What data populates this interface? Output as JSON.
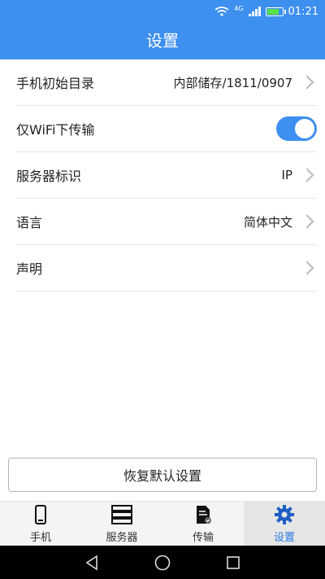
{
  "status_bar": {
    "network": "4G",
    "time": "01:21"
  },
  "header": {
    "title": "设置"
  },
  "settings": {
    "initial_dir": {
      "label": "手机初始目录",
      "value": "内部储存/1811/0907"
    },
    "wifi_only": {
      "label": "仅WiFi下传输",
      "enabled": true
    },
    "server_id": {
      "label": "服务器标识",
      "value": "IP"
    },
    "language": {
      "label": "语言",
      "value": "简体中文"
    },
    "statement": {
      "label": "声明"
    }
  },
  "restore_button": {
    "label": "恢复默认设置"
  },
  "tabs": [
    {
      "label": "手机",
      "icon": "phone-icon"
    },
    {
      "label": "服务器",
      "icon": "server-icon"
    },
    {
      "label": "传输",
      "icon": "document-icon"
    },
    {
      "label": "设置",
      "icon": "gear-icon",
      "active": true
    }
  ],
  "colors": {
    "accent": "#3d8ff0",
    "active_tab": "#2a7be6"
  }
}
